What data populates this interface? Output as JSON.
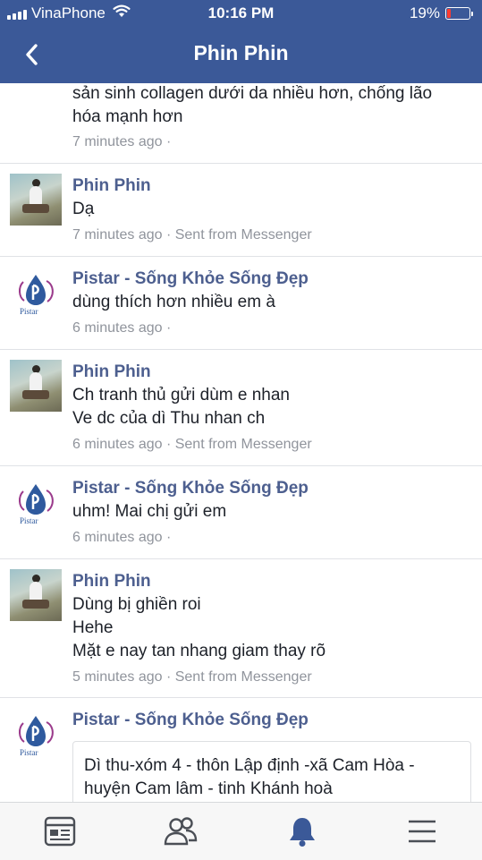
{
  "status_bar": {
    "carrier": "VinaPhone",
    "time": "10:16 PM",
    "battery": "19%",
    "battery_level": 0.19
  },
  "header": {
    "title": "Phin Phin"
  },
  "comments": [
    {
      "lines": [
        "sản sinh collagen dưới da nhiều hơn, chống lão",
        "hóa mạnh hơn"
      ],
      "meta": "7 minutes ago ·"
    },
    {
      "author": "Phin Phin",
      "avatar": "profile-photo",
      "lines": [
        "Dạ"
      ],
      "meta": "7 minutes ago · Sent from Messenger"
    },
    {
      "author": "Pistar - Sống Khỏe Sống Đẹp",
      "avatar": "pistar-logo",
      "lines": [
        "dùng thích hơn nhiều em à"
      ],
      "meta": "6 minutes ago ·"
    },
    {
      "author": "Phin Phin",
      "avatar": "profile-photo",
      "lines": [
        "Ch tranh thủ gửi dùm e nhan",
        "Ve dc của dì Thu nhan ch"
      ],
      "meta": "6 minutes ago · Sent from Messenger"
    },
    {
      "author": "Pistar - Sống Khỏe Sống Đẹp",
      "avatar": "pistar-logo",
      "lines": [
        "uhm! Mai chị gửi em"
      ],
      "meta": "6 minutes ago ·"
    },
    {
      "author": "Phin Phin",
      "avatar": "profile-photo",
      "lines": [
        "Dùng bị ghiền roi",
        "Hehe",
        "Mặt e nay tan nhang giam thay rõ"
      ],
      "meta": "5 minutes ago · Sent from Messenger"
    },
    {
      "author": "Pistar - Sống Khỏe Sống Đẹp",
      "avatar": "pistar-logo",
      "quote_lines": [
        "Dì thu-xóm 4 - thôn Lập định -xã Cam Hòa -",
        "huyện Cam lâm - tinh Khánh hoà"
      ]
    }
  ],
  "logo_text": "Pistar",
  "tabbar": {
    "items": [
      {
        "icon": "news-feed-icon",
        "active": false
      },
      {
        "icon": "friends-icon",
        "active": false
      },
      {
        "icon": "notifications-bell-icon",
        "active": true
      },
      {
        "icon": "menu-icon",
        "active": false
      }
    ]
  },
  "colors": {
    "brand": "#3b5998",
    "author": "#4d5f8f",
    "meta": "#90949c",
    "text": "#1d2129",
    "battery_low": "#ff3b30"
  }
}
